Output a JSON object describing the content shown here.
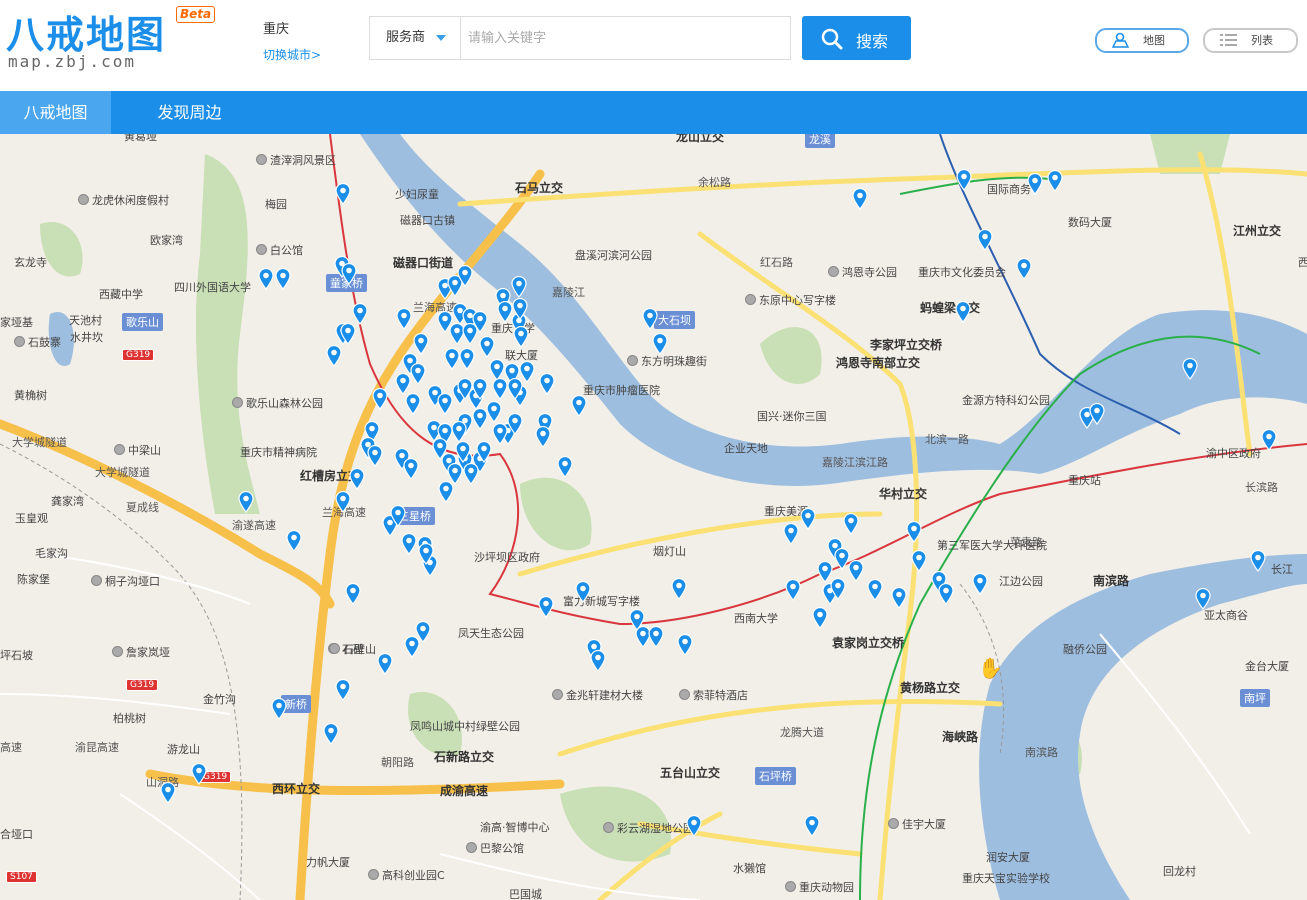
{
  "header": {
    "logo_text": "八戒地图",
    "beta": "Beta",
    "domain": "map.zbj.com",
    "city": "重庆",
    "switch_city": "切换城市>",
    "search_type": "服务商",
    "search_placeholder": "请输入关键字",
    "search_button": "搜索",
    "view_map": "地图",
    "view_list": "列表"
  },
  "nav": {
    "tabs": [
      "八戒地图",
      "发现周边"
    ]
  },
  "colors": {
    "brand": "#1a8ee8",
    "water": "#9ebee0",
    "park": "#c9dfb5",
    "highway": "#f7c04a",
    "main_road": "#fbe173",
    "rail": "#d9363e",
    "pin": "#1a8ee8"
  },
  "map": {
    "labels": [
      "黄葛垭",
      "渣滓洞风景区",
      "少妇尿童",
      "磁器口古镇",
      "龙虎休闲度假村",
      "梅园",
      "欧家湾",
      "白公馆",
      "玄龙寺",
      "西藏中学",
      "四川外国语大学",
      "磁器口街道",
      "石马立交",
      "龙山立交",
      "余松路",
      "红石路",
      "盘溪河滨河公园",
      "鸿恩寺公园",
      "重庆市文化委员会",
      "国际商务",
      "数码大厦",
      "江州立交",
      "嘉陵江",
      "天池村",
      "水井坎",
      "家垭基",
      "石鼓寨",
      "黄桷树",
      "歌乐山森林公园",
      "重庆大学",
      "联大厦",
      "东原中心写字楼",
      "蚂蝗梁立交",
      "李家坪立交桥",
      "鸿恩寺南部立交",
      "东方明珠趣街",
      "重庆市肿瘤医院",
      "中梁山",
      "重庆市精神病院",
      "国兴·迷你三国",
      "金源方特科幻公园",
      "企业天地",
      "北滨一路",
      "嘉陵江滨江路",
      "重庆站",
      "渝中区政府",
      "长滨路",
      "大学城隧道",
      "大学城隧道",
      "红槽房立交",
      "华村立交",
      "龚家湾",
      "玉皇观",
      "毛家沟",
      "陈家堡",
      "桐子沟垭口",
      "重庆美源",
      "烟灯山",
      "沙坪坝区政府",
      "第三军医大学大坪医院",
      "菜袁路",
      "江边公园",
      "南滨路",
      "长江",
      "富力新城写字楼",
      "西南大学",
      "凤天生态公园",
      "石碑",
      "袁家岗立交桥",
      "亚太商谷",
      "融侨公园",
      "金台大厦",
      "坪石坡",
      "詹家岚垭",
      "石壁山",
      "金兆轩建材大楼",
      "索菲特酒店",
      "黄杨路立交",
      "金竹沟",
      "柏桃树",
      "凤鸣山城中村绿壁公园",
      "朝阳路",
      "石新路立交",
      "龙腾大道",
      "海峡路",
      "南滨路",
      "游龙山",
      "山洞路",
      "西环立交",
      "成渝高速",
      "五台山立交",
      "渝高·智博中心",
      "彩云湖湿地公园",
      "佳宇大厦",
      "润安大厦",
      "巴黎公馆",
      "力帆大厦",
      "高科创业园C",
      "水獭馆",
      "重庆动物园",
      "重庆天宝实验学校",
      "回龙村",
      "巴国城",
      "合垭口",
      "西西",
      "兰海高速",
      "兰海高速",
      "渝遂高速",
      "渝昆高速",
      "高速",
      "夏成线"
    ],
    "stations": [
      "龙溪",
      "童家桥",
      "歌乐山",
      "大石坝",
      "三星桥",
      "新桥",
      "石坪桥",
      "南坪"
    ],
    "shields": [
      "G319",
      "G319",
      "G319",
      "S107"
    ],
    "pin_count": 137
  }
}
